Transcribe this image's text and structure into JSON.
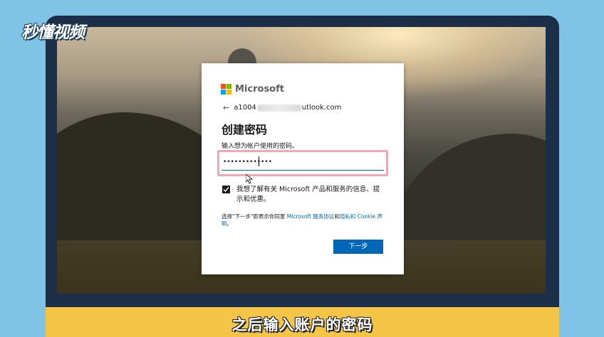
{
  "watermark": "秒懂视频",
  "dialog": {
    "brand": "Microsoft",
    "logo_colors": [
      "#f25022",
      "#7fba00",
      "#00a4ef",
      "#ffb900"
    ],
    "account_prefix": "a1004",
    "account_suffix": "utlook.com",
    "title": "创建密码",
    "instruction": "输入想为帐户使用的密码。",
    "password_masked": "•••••••••••••",
    "checkbox_checked": true,
    "checkbox_label": "我想了解有关 Microsoft 产品和服务的信息、提示和优惠。",
    "legal": {
      "text_before": "选择\"下一步\"即表示你同意 ",
      "link_services": "Microsoft 服务协议",
      "text_and": "和",
      "link_privacy": "隐私和 Cookie 声明",
      "text_end": "。"
    },
    "next_label": "下一步",
    "accent_color": "#0067b8"
  },
  "caption": "之后输入账户的密码"
}
